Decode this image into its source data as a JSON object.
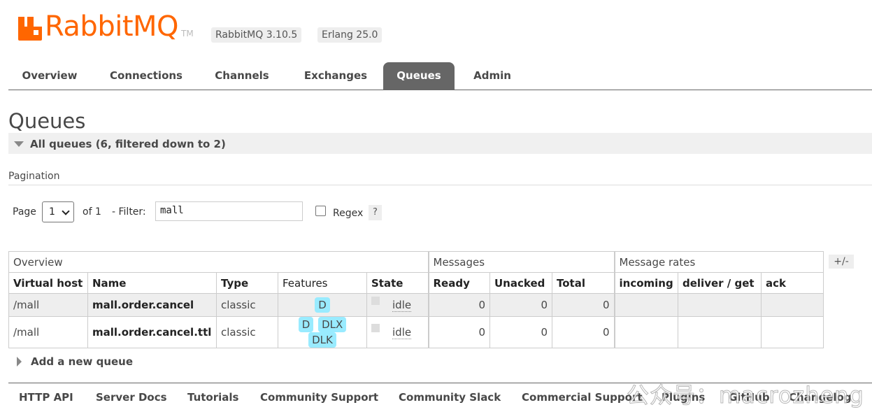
{
  "header": {
    "logo_text": "RabbitMQ",
    "logo_tm": "TM",
    "rabbitmq_version": "RabbitMQ 3.10.5",
    "erlang_version": "Erlang 25.0",
    "brand_color": "#ff6600"
  },
  "tabs": [
    {
      "label": "Overview"
    },
    {
      "label": "Connections"
    },
    {
      "label": "Channels"
    },
    {
      "label": "Exchanges"
    },
    {
      "label": "Queues",
      "active": true
    },
    {
      "label": "Admin"
    }
  ],
  "page": {
    "title": "Queues",
    "section_label": "All queues (6, filtered down to 2)"
  },
  "pagination": {
    "label": "Pagination",
    "page_label": "Page",
    "page_value": "1",
    "of_label": "of 1",
    "filter_label": "- Filter:",
    "filter_value": "mall",
    "regex_label": "Regex",
    "help_label": "?"
  },
  "table": {
    "groups": [
      "Overview",
      "Messages",
      "Message rates"
    ],
    "toggle_label": "+/-",
    "columns": [
      "Virtual host",
      "Name",
      "Type",
      "Features",
      "State",
      "Ready",
      "Unacked",
      "Total",
      "incoming",
      "deliver / get",
      "ack"
    ],
    "rows": [
      {
        "vhost": "/mall",
        "name": "mall.order.cancel",
        "type": "classic",
        "features": [
          "D"
        ],
        "state": "idle",
        "ready": "0",
        "unacked": "0",
        "total": "0",
        "incoming": "",
        "deliver_get": "",
        "ack": ""
      },
      {
        "vhost": "/mall",
        "name": "mall.order.cancel.ttl",
        "type": "classic",
        "features": [
          "D",
          "DLX",
          "DLK"
        ],
        "state": "idle",
        "ready": "0",
        "unacked": "0",
        "total": "0",
        "incoming": "",
        "deliver_get": "",
        "ack": ""
      }
    ]
  },
  "add_queue_label": "Add a new queue",
  "footer": {
    "links": [
      "HTTP API",
      "Server Docs",
      "Tutorials",
      "Community Support",
      "Community Slack",
      "Commercial Support",
      "Plugins",
      "GitHub",
      "Changelog"
    ]
  },
  "watermark": "公众号：macrozheng"
}
